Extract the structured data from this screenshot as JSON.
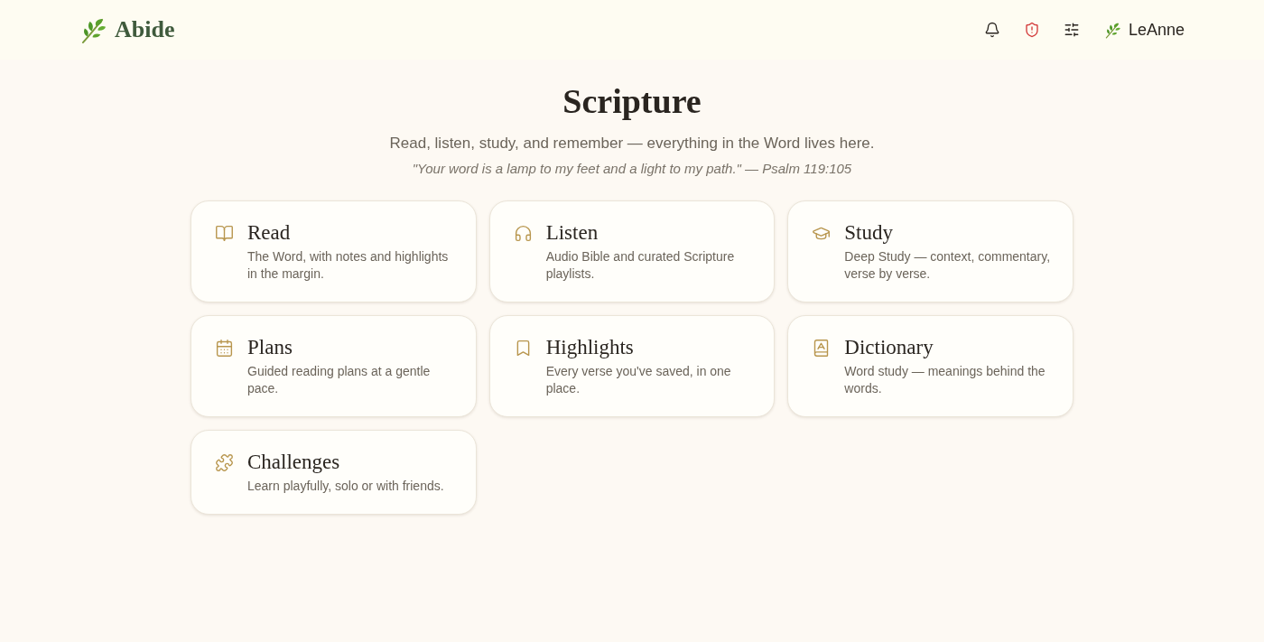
{
  "header": {
    "brand": "Abide",
    "user": "LeAnne"
  },
  "page": {
    "title": "Scripture",
    "subtitle": "Read, listen, study, and remember — everything in the Word lives here.",
    "verse": "\"Your word is a lamp to my feet and a light to my path.\" — Psalm 119:105"
  },
  "cards": [
    {
      "title": "Read",
      "description": "The Word, with notes and highlights in the margin."
    },
    {
      "title": "Listen",
      "description": "Audio Bible and curated Scripture playlists."
    },
    {
      "title": "Study",
      "description": "Deep Study — context, commentary, verse by verse."
    },
    {
      "title": "Plans",
      "description": "Guided reading plans at a gentle pace."
    },
    {
      "title": "Highlights",
      "description": "Every verse you've saved, in one place."
    },
    {
      "title": "Dictionary",
      "description": "Word study — meanings behind the words."
    },
    {
      "title": "Challenges",
      "description": "Learn playfully, solo or with friends."
    }
  ]
}
